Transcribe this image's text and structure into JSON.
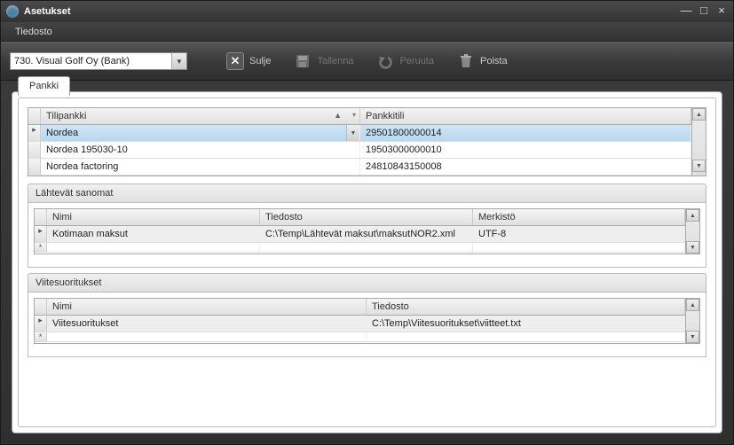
{
  "window": {
    "title": "Asetukset"
  },
  "menu": {
    "file": "Tiedosto"
  },
  "toolbar": {
    "combo_value": "730. Visual Golf Oy (Bank)",
    "close": "Sulje",
    "save": "Tallenna",
    "cancel": "Peruuta",
    "delete": "Poista"
  },
  "tabs": {
    "bank": "Pankki"
  },
  "grid1": {
    "col1": "Tilipankki",
    "col2": "Pankkitili",
    "rows": [
      {
        "bank": "Nordea",
        "account": "29501800000014"
      },
      {
        "bank": "Nordea 195030-10",
        "account": "19503000000010"
      },
      {
        "bank": "Nordea factoring",
        "account": "24810843150008"
      }
    ]
  },
  "section2": {
    "title": "Lähtevät sanomat",
    "col1": "Nimi",
    "col2": "Tiedosto",
    "col3": "Merkistö",
    "rows": [
      {
        "name": "Kotimaan maksut",
        "file": "C:\\Temp\\Lähtevät maksut\\maksutNOR2.xml",
        "charset": "UTF-8"
      }
    ]
  },
  "section3": {
    "title": "Viitesuoritukset",
    "col1": "Nimi",
    "col2": "Tiedosto",
    "rows": [
      {
        "name": "Viitesuoritukset",
        "file": "C:\\Temp\\Viitesuoritukset\\viitteet.txt"
      }
    ]
  }
}
